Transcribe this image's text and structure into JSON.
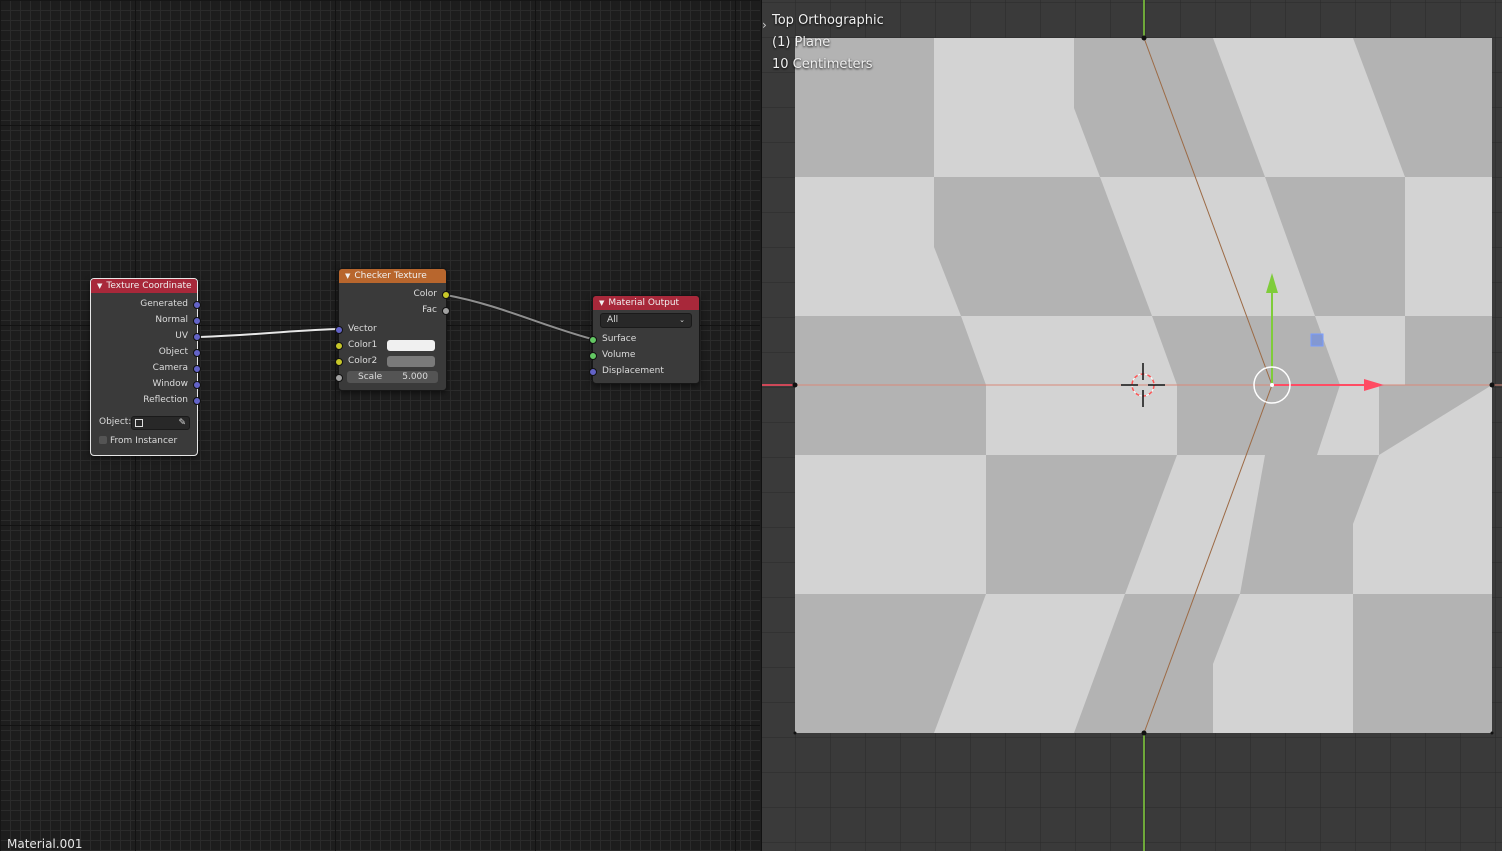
{
  "node_editor": {
    "material_name": "Material.001",
    "nodes": {
      "texture_coordinate": {
        "title": "Texture Coordinate",
        "outputs": [
          "Generated",
          "Normal",
          "UV",
          "Object",
          "Camera",
          "Window",
          "Reflection"
        ],
        "object_label": "Object:",
        "from_instancer_label": "From Instancer",
        "from_instancer_checked": false,
        "header_color": "#a8283a"
      },
      "checker_texture": {
        "title": "Checker Texture",
        "outputs": [
          "Color",
          "Fac"
        ],
        "inputs": [
          "Vector",
          "Color1",
          "Color2"
        ],
        "scale_label": "Scale",
        "scale_value": "5.000",
        "color1": "#f0f0f0",
        "color2": "#7a7a7a",
        "header_color": "#b8662d"
      },
      "material_output": {
        "title": "Material Output",
        "target": "All",
        "inputs": [
          "Surface",
          "Volume",
          "Displacement"
        ],
        "header_color": "#a8283a"
      }
    }
  },
  "viewport": {
    "view_name": "Top Orthographic",
    "object_name": "(1) Plane",
    "grid_scale": "10 Centimeters",
    "checker_light": "#d3d3d3",
    "checker_dark": "#b3b3b3",
    "axis_x_color": "#ff4c63",
    "axis_y_color": "#7fcc3a"
  }
}
